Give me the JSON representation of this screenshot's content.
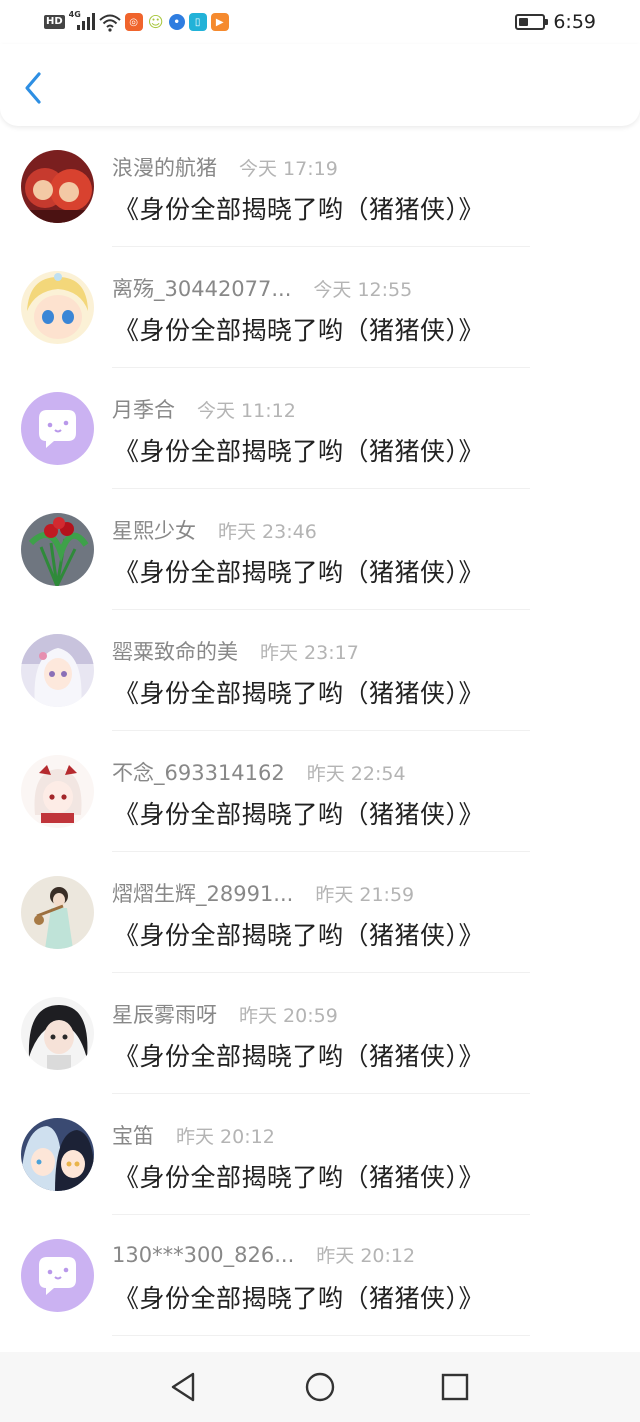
{
  "status_bar": {
    "network_badge": "HD",
    "signal_type": "4G",
    "time": "6:59",
    "app_icons": [
      "app-icon-orange",
      "app-icon-emoji",
      "app-icon-blue",
      "app-icon-cyan",
      "app-icon-video"
    ],
    "battery_level": 0.3
  },
  "header": {
    "back_icon": "chevron-left-icon",
    "accent_color": "#2e8fe3"
  },
  "items": [
    {
      "name": "浪漫的航猪",
      "time": "今天 17:19",
      "title": "《身份全部揭晓了哟（猪猪侠）》",
      "avatar": "avatar-red-cartoon"
    },
    {
      "name": "离殇_30442077...",
      "time": "今天 12:55",
      "title": "《身份全部揭晓了哟（猪猪侠）》",
      "avatar": "avatar-blonde-anime"
    },
    {
      "name": "月季合",
      "time": "今天 11:12",
      "title": "《身份全部揭晓了哟（猪猪侠）》",
      "avatar": "default-chat-avatar-icon"
    },
    {
      "name": "星熙少女",
      "time": "昨天 23:46",
      "title": "《身份全部揭晓了哟（猪猪侠）》",
      "avatar": "avatar-flowers"
    },
    {
      "name": "罂粟致命的美",
      "time": "昨天 23:17",
      "title": "《身份全部揭晓了哟（猪猪侠）》",
      "avatar": "avatar-white-hair-anime"
    },
    {
      "name": "不念_693314162",
      "time": "昨天 22:54",
      "title": "《身份全部揭晓了哟（猪猪侠）》",
      "avatar": "avatar-chibi-red"
    },
    {
      "name": "熠熠生辉_28991...",
      "time": "昨天 21:59",
      "title": "《身份全部揭晓了哟（猪猪侠）》",
      "avatar": "avatar-traditional-figure"
    },
    {
      "name": "星辰雾雨呀",
      "time": "昨天 20:59",
      "title": "《身份全部揭晓了哟（猪猪侠）》",
      "avatar": "avatar-dark-hair-anime"
    },
    {
      "name": "宝笛",
      "time": "昨天 20:12",
      "title": "《身份全部揭晓了哟（猪猪侠）》",
      "avatar": "avatar-two-anime"
    },
    {
      "name": "130***300_826...",
      "time": "昨天 20:12",
      "title": "《身份全部揭晓了哟（猪猪侠）》",
      "avatar": "default-chat-avatar-icon"
    }
  ],
  "nav_bar": {
    "back": "triangle-back-icon",
    "home": "circle-home-icon",
    "recents": "square-recents-icon"
  }
}
